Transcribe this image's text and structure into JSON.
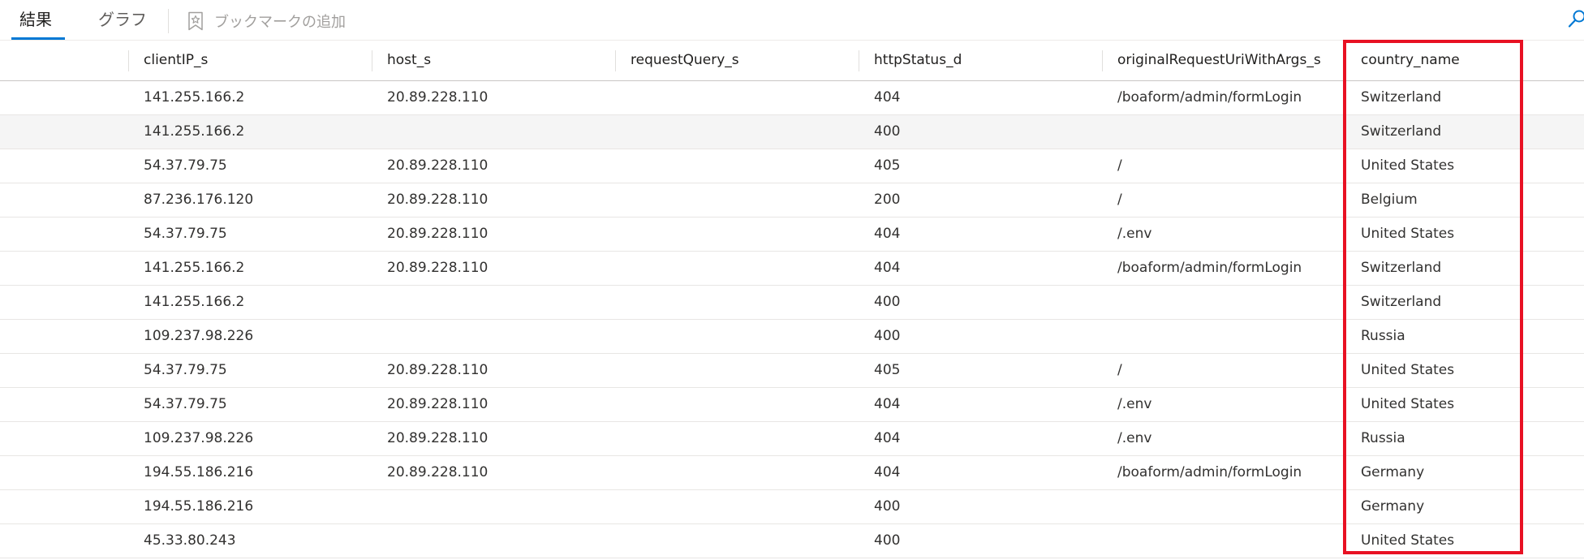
{
  "tabs": [
    {
      "label": "結果"
    },
    {
      "label": "グラフ"
    }
  ],
  "bookmark": {
    "label": "ブックマークの追加"
  },
  "columns": [
    "clientIP_s",
    "host_s",
    "requestQuery_s",
    "httpStatus_d",
    "originalRequestUriWithArgs_s",
    "country_name"
  ],
  "rows": [
    {
      "clientIP_s": "141.255.166.2",
      "host_s": "20.89.228.110",
      "requestQuery_s": "",
      "httpStatus_d": "404",
      "originalRequestUriWithArgs_s": "/boaform/admin/formLogin",
      "country_name": "Switzerland"
    },
    {
      "clientIP_s": "141.255.166.2",
      "host_s": "",
      "requestQuery_s": "",
      "httpStatus_d": "400",
      "originalRequestUriWithArgs_s": "",
      "country_name": "Switzerland"
    },
    {
      "clientIP_s": "54.37.79.75",
      "host_s": "20.89.228.110",
      "requestQuery_s": "",
      "httpStatus_d": "405",
      "originalRequestUriWithArgs_s": "/",
      "country_name": "United States"
    },
    {
      "clientIP_s": "87.236.176.120",
      "host_s": "20.89.228.110",
      "requestQuery_s": "",
      "httpStatus_d": "200",
      "originalRequestUriWithArgs_s": "/",
      "country_name": "Belgium"
    },
    {
      "clientIP_s": "54.37.79.75",
      "host_s": "20.89.228.110",
      "requestQuery_s": "",
      "httpStatus_d": "404",
      "originalRequestUriWithArgs_s": "/.env",
      "country_name": "United States"
    },
    {
      "clientIP_s": "141.255.166.2",
      "host_s": "20.89.228.110",
      "requestQuery_s": "",
      "httpStatus_d": "404",
      "originalRequestUriWithArgs_s": "/boaform/admin/formLogin",
      "country_name": "Switzerland"
    },
    {
      "clientIP_s": "141.255.166.2",
      "host_s": "",
      "requestQuery_s": "",
      "httpStatus_d": "400",
      "originalRequestUriWithArgs_s": "",
      "country_name": "Switzerland"
    },
    {
      "clientIP_s": "109.237.98.226",
      "host_s": "",
      "requestQuery_s": "",
      "httpStatus_d": "400",
      "originalRequestUriWithArgs_s": "",
      "country_name": "Russia"
    },
    {
      "clientIP_s": "54.37.79.75",
      "host_s": "20.89.228.110",
      "requestQuery_s": "",
      "httpStatus_d": "405",
      "originalRequestUriWithArgs_s": "/",
      "country_name": "United States"
    },
    {
      "clientIP_s": "54.37.79.75",
      "host_s": "20.89.228.110",
      "requestQuery_s": "",
      "httpStatus_d": "404",
      "originalRequestUriWithArgs_s": "/.env",
      "country_name": "United States"
    },
    {
      "clientIP_s": "109.237.98.226",
      "host_s": "20.89.228.110",
      "requestQuery_s": "",
      "httpStatus_d": "404",
      "originalRequestUriWithArgs_s": "/.env",
      "country_name": "Russia"
    },
    {
      "clientIP_s": "194.55.186.216",
      "host_s": "20.89.228.110",
      "requestQuery_s": "",
      "httpStatus_d": "404",
      "originalRequestUriWithArgs_s": "/boaform/admin/formLogin",
      "country_name": "Germany"
    },
    {
      "clientIP_s": "194.55.186.216",
      "host_s": "",
      "requestQuery_s": "",
      "httpStatus_d": "400",
      "originalRequestUriWithArgs_s": "",
      "country_name": "Germany"
    },
    {
      "clientIP_s": "45.33.80.243",
      "host_s": "",
      "requestQuery_s": "",
      "httpStatus_d": "400",
      "originalRequestUriWithArgs_s": "",
      "country_name": "United States"
    }
  ],
  "icons": {
    "bookmark": "bookmark-add-icon",
    "search": "search-icon"
  },
  "colors": {
    "accent": "#0078d4",
    "highlight": "#e81123",
    "alt_row": "#f5f5f5"
  }
}
